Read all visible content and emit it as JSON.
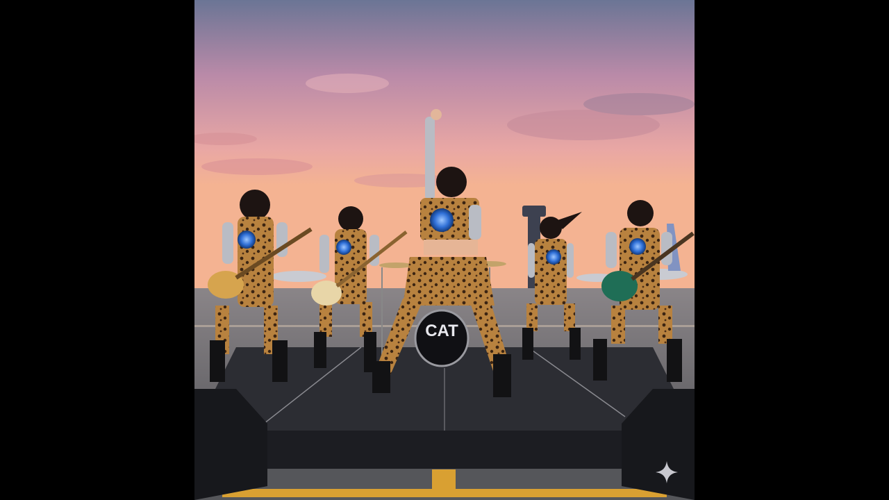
{
  "image": {
    "description_label": "",
    "logo_main_text": "CAT",
    "logo_sub_text": "",
    "colors": {
      "letterbox": "#000000",
      "sky_top": "#5f6d8f",
      "sky_mid": "#c98aa0",
      "sky_horizon": "#f2a98c",
      "stage": "#2a2b30",
      "tarmac": "#6d6e74",
      "leopard": "#b07a3e",
      "silver": "#b9bcc4",
      "logo_glow": "#3a78d8",
      "runway_yellow": "#d9a032"
    }
  },
  "overlay": {
    "icon": "sparkle-icon"
  }
}
